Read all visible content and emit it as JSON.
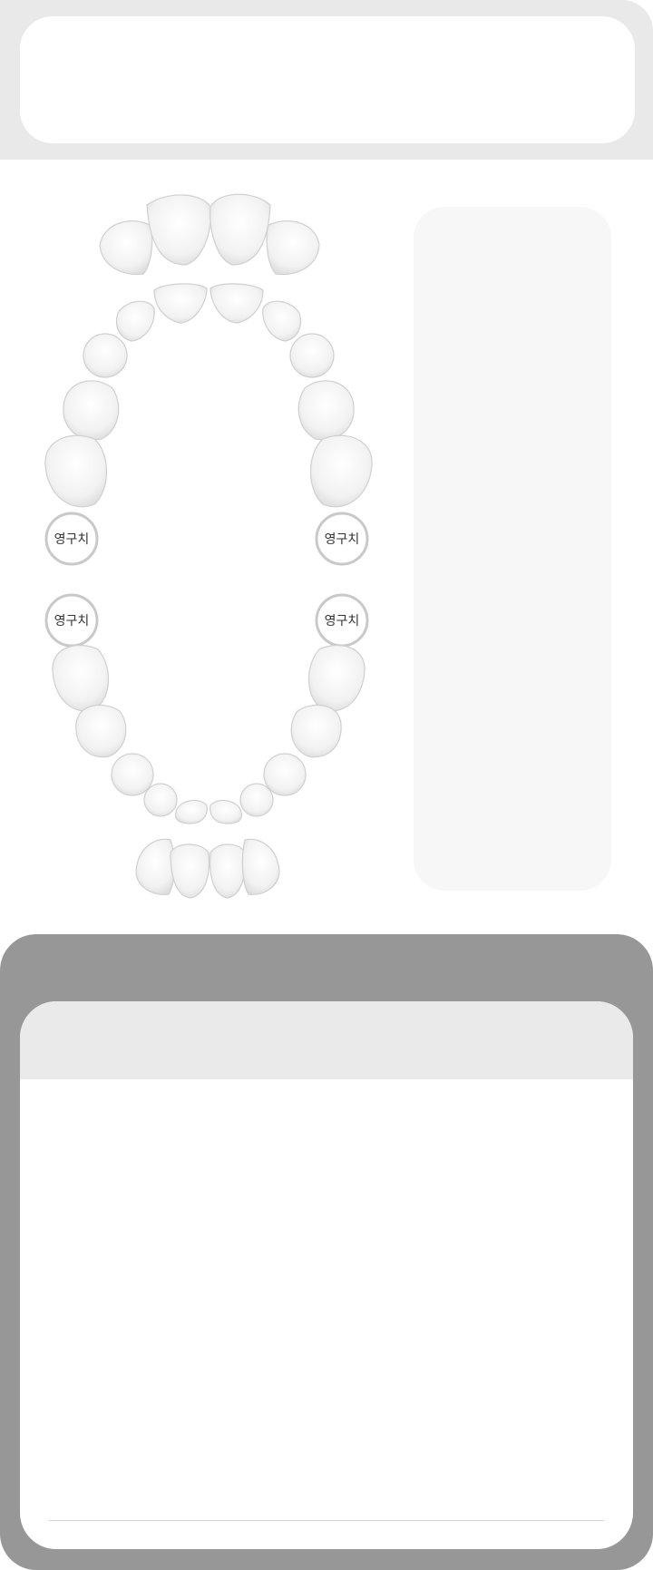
{
  "jaw_chart": {
    "badges": {
      "upper_right": "영구치",
      "upper_left": "영구치",
      "lower_right": "영구치",
      "lower_left": "영구치"
    }
  },
  "colors": {
    "top_bg": "#e9e9e9",
    "panel_bg": "#f7f7f7",
    "bottom_bg": "#979797",
    "detail_header_bg": "#eaeaea"
  }
}
